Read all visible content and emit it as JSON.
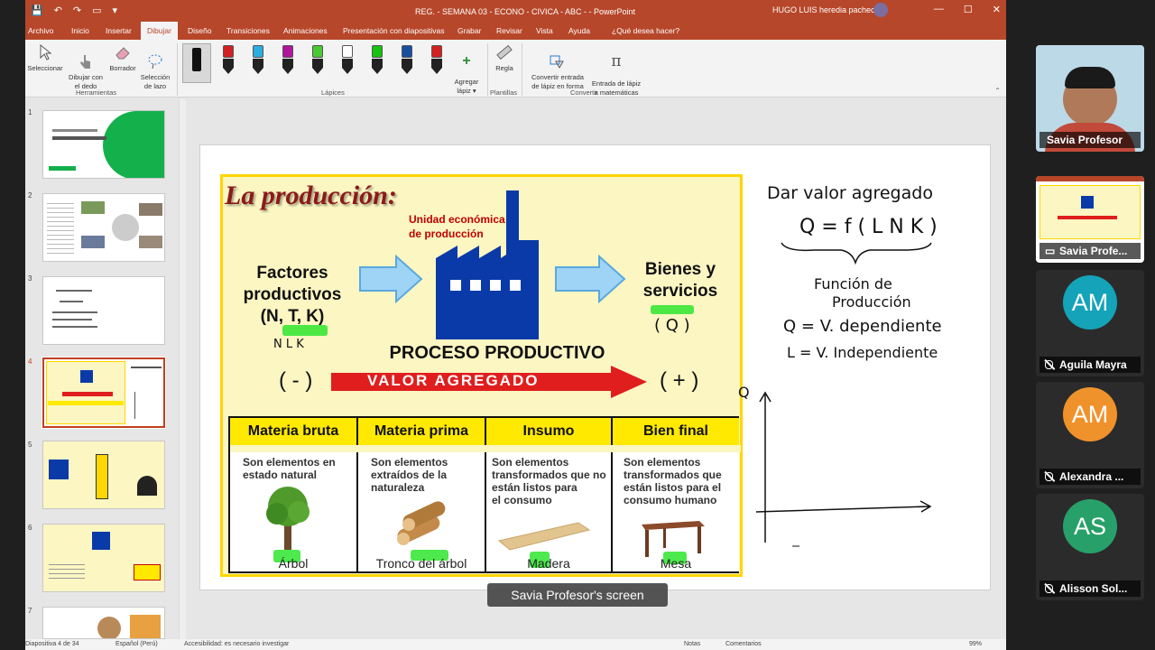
{
  "titlebar": {
    "document": "REG. - SEMANA 03 - ECONO - CIVICA - ABC -  -  PowerPoint",
    "user": "HUGO LUIS heredia pacheco",
    "win_min": "—",
    "win_max": "☐",
    "win_close": "✕",
    "qat": [
      "💾",
      "↶",
      "↷",
      "▭",
      "▾"
    ]
  },
  "tabs": [
    "Archivo",
    "Inicio",
    "Insertar",
    "Dibujar",
    "Diseño",
    "Transiciones",
    "Animaciones",
    "Presentación con diapositivas",
    "Grabar",
    "Revisar",
    "Vista",
    "Ayuda",
    "¿Qué desea hacer?"
  ],
  "ribbon": {
    "herramientas": {
      "select": "Seleccionar",
      "finger": "Dibujar con\nel dedo",
      "eraser": "Borrador",
      "lasso": "Selección\nde lazo",
      "group": "Herramientas"
    },
    "lapices": {
      "group": "Lápices",
      "add": "Agregar\nlápiz ▾",
      "pen_colors": [
        "#d42020",
        "#2aaee0",
        "#b0159c",
        "#49c932",
        "#ffffff",
        "#17c30f",
        "#1a4fa0",
        "#d42020"
      ]
    },
    "plantillas": {
      "ruler": "Regla",
      "group": "Plantillas"
    },
    "convertir": {
      "shape": "Convertir entrada\nde lápiz en forma",
      "math": "Entrada de lápiz\na matemáticas",
      "group": "Convertir"
    }
  },
  "thumbnails": {
    "numbers": [
      "1",
      "2",
      "3",
      "4",
      "5",
      "6",
      "7"
    ],
    "selected": "4"
  },
  "slide": {
    "title": "La producción:",
    "unit_label": "Unidad económica\nde producción",
    "factores": "Factores\nproductivos\n(N, T, K)",
    "bienes": "Bienes y\nservicios",
    "proceso": "PROCESO PRODUCTIVO",
    "valor": "VALOR AGREGADO",
    "minus": "( - )",
    "plus": "( + )",
    "columns": [
      "Materia bruta",
      "Materia prima",
      "Insumo",
      "Bien final"
    ],
    "descriptions": [
      "Son elementos en\nestado natural",
      "Son elementos\nextraídos de la\nnaturaleza",
      "Son elementos\ntransformados que no\nestán listos para\nel consumo",
      "Son elementos\ntransformados que\nestán listos para el\nconsumo humano"
    ],
    "captions": [
      "Árbol",
      "Tronco del árbol",
      "Madera",
      "Mesa"
    ],
    "ink": {
      "nlk": "N  L  K",
      "q_circle": "( Q )",
      "line1": "Dar valor agregado",
      "formula": "Q = f ( L N K )",
      "func1": "Función de",
      "func2": "Producción",
      "dep": "Q = V. dependiente",
      "indep": "L = V. Independiente",
      "graph_label": "Q"
    }
  },
  "status": {
    "slide": "Diapositiva 4 de 34",
    "lang": "Español (Perú)",
    "access": "Accesibilidad: es necesario investigar",
    "notes": "Notas",
    "comments": "Comentarios",
    "zoom": "99%"
  },
  "screen_label": "Savia Profesor's screen",
  "participants": [
    {
      "name": "Savia Profesor",
      "type": "video"
    },
    {
      "name": "Savia Profe...",
      "type": "share"
    },
    {
      "initials": "AM",
      "name": "Aguila Mayra",
      "color": "#14a3b8"
    },
    {
      "initials": "AM",
      "name": "Alexandra ...",
      "color": "#f0922c"
    },
    {
      "initials": "AS",
      "name": "Alisson Sol...",
      "color": "#27a06a"
    }
  ]
}
